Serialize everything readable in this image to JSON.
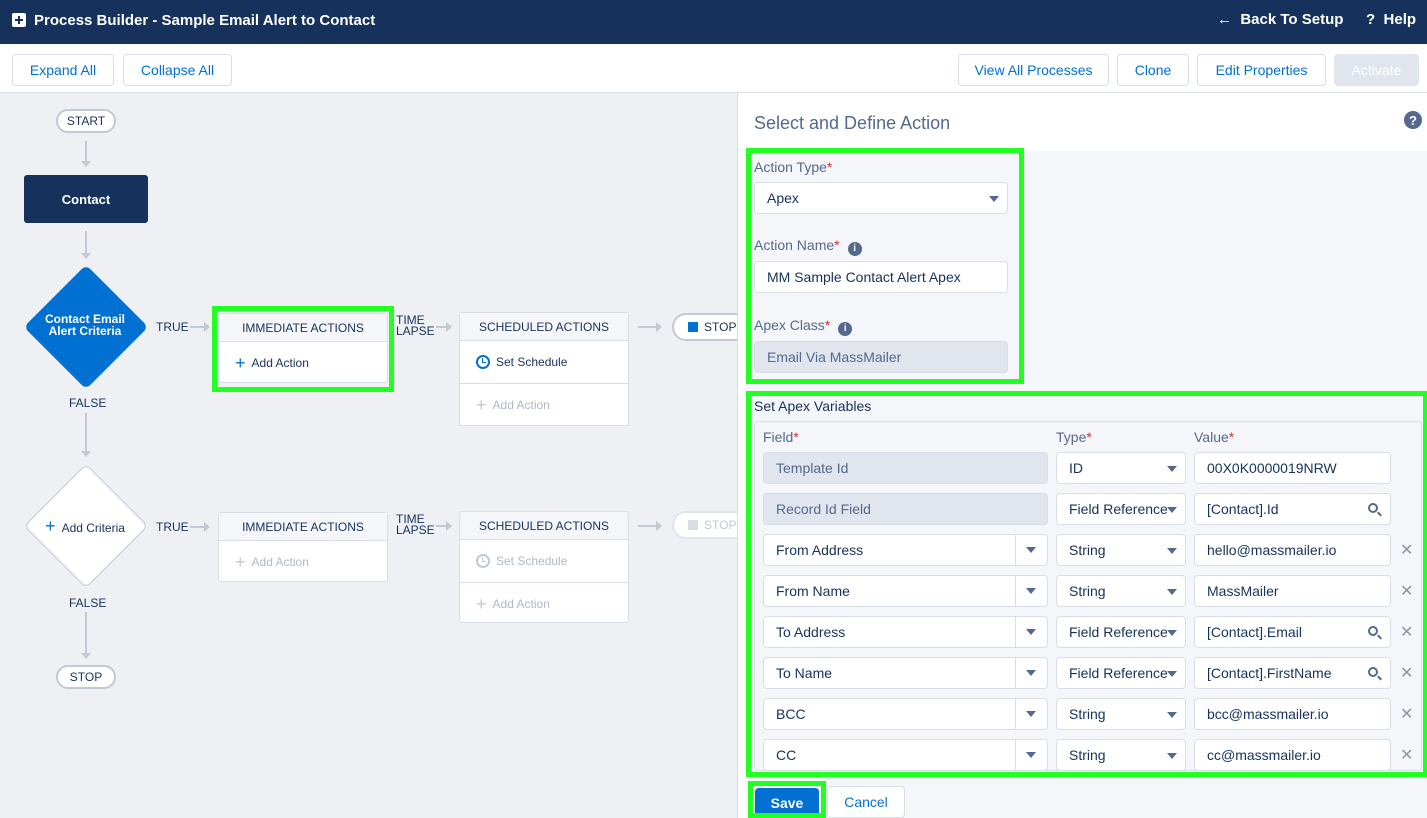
{
  "header": {
    "title": "Process Builder - Sample Email Alert to Contact",
    "back_label": "Back To Setup",
    "help_label": "Help",
    "back_icon": "←",
    "help_icon": "?"
  },
  "toolbar": {
    "expand_all": "Expand All",
    "collapse_all": "Collapse All",
    "view_all_processes": "View All Processes",
    "clone": "Clone",
    "edit_properties": "Edit Properties",
    "activate": "Activate"
  },
  "canvas": {
    "start": "START",
    "object": "Contact",
    "criteria1": {
      "name": "Contact Email Alert Criteria",
      "true_label": "TRUE",
      "false_label": "FALSE"
    },
    "criteria2": {
      "name": "Add Criteria",
      "true_label": "TRUE",
      "false_label": "FALSE"
    },
    "immediate_actions": "IMMEDIATE ACTIONS",
    "scheduled_actions": "SCHEDULED ACTIONS",
    "time_lapse": "TIME LAPSE",
    "add_action": "Add Action",
    "set_schedule": "Set Schedule",
    "stop": "STOP"
  },
  "panel": {
    "title": "Select and Define Action",
    "action_type": {
      "label": "Action Type",
      "value": "Apex"
    },
    "action_name": {
      "label": "Action Name",
      "value": "MM Sample Contact Alert Apex"
    },
    "apex_class": {
      "label": "Apex Class",
      "value": "Email Via MassMailer"
    },
    "apex_variables": {
      "label": "Set Apex Variables",
      "columns": {
        "field": "Field",
        "type": "Type",
        "value": "Value"
      },
      "rows": [
        {
          "field": "Template Id",
          "type": "ID",
          "value": "00X0K0000019NRW",
          "locked": true,
          "lookup": false,
          "removable": false
        },
        {
          "field": "Record Id Field",
          "type": "Field Reference",
          "value": "[Contact].Id",
          "locked": true,
          "lookup": true,
          "removable": false
        },
        {
          "field": "From Address",
          "type": "String",
          "value": "hello@massmailer.io",
          "locked": false,
          "lookup": false,
          "removable": true
        },
        {
          "field": "From Name",
          "type": "String",
          "value": "MassMailer",
          "locked": false,
          "lookup": false,
          "removable": true
        },
        {
          "field": "To Address",
          "type": "Field Reference",
          "value": "[Contact].Email",
          "locked": false,
          "lookup": true,
          "removable": true
        },
        {
          "field": "To Name",
          "type": "Field Reference",
          "value": "[Contact].FirstName",
          "locked": false,
          "lookup": true,
          "removable": true
        },
        {
          "field": "BCC",
          "type": "String",
          "value": "bcc@massmailer.io",
          "locked": false,
          "lookup": false,
          "removable": true
        },
        {
          "field": "CC",
          "type": "String",
          "value": "cc@massmailer.io",
          "locked": false,
          "lookup": false,
          "removable": true
        }
      ]
    },
    "save": "Save",
    "cancel": "Cancel"
  },
  "colors": {
    "header_bg": "#16325c",
    "accent": "#0070d2",
    "highlight": "#22ff22"
  }
}
